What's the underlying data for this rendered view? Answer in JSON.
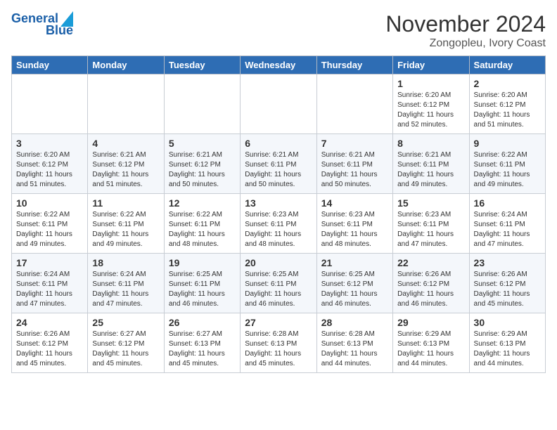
{
  "header": {
    "logo_line1": "General",
    "logo_line2": "Blue",
    "title": "November 2024",
    "subtitle": "Zongopleu, Ivory Coast"
  },
  "days_of_week": [
    "Sunday",
    "Monday",
    "Tuesday",
    "Wednesday",
    "Thursday",
    "Friday",
    "Saturday"
  ],
  "weeks": [
    [
      {
        "day": "",
        "info": ""
      },
      {
        "day": "",
        "info": ""
      },
      {
        "day": "",
        "info": ""
      },
      {
        "day": "",
        "info": ""
      },
      {
        "day": "",
        "info": ""
      },
      {
        "day": "1",
        "info": "Sunrise: 6:20 AM\nSunset: 6:12 PM\nDaylight: 11 hours\nand 52 minutes."
      },
      {
        "day": "2",
        "info": "Sunrise: 6:20 AM\nSunset: 6:12 PM\nDaylight: 11 hours\nand 51 minutes."
      }
    ],
    [
      {
        "day": "3",
        "info": "Sunrise: 6:20 AM\nSunset: 6:12 PM\nDaylight: 11 hours\nand 51 minutes."
      },
      {
        "day": "4",
        "info": "Sunrise: 6:21 AM\nSunset: 6:12 PM\nDaylight: 11 hours\nand 51 minutes."
      },
      {
        "day": "5",
        "info": "Sunrise: 6:21 AM\nSunset: 6:12 PM\nDaylight: 11 hours\nand 50 minutes."
      },
      {
        "day": "6",
        "info": "Sunrise: 6:21 AM\nSunset: 6:11 PM\nDaylight: 11 hours\nand 50 minutes."
      },
      {
        "day": "7",
        "info": "Sunrise: 6:21 AM\nSunset: 6:11 PM\nDaylight: 11 hours\nand 50 minutes."
      },
      {
        "day": "8",
        "info": "Sunrise: 6:21 AM\nSunset: 6:11 PM\nDaylight: 11 hours\nand 49 minutes."
      },
      {
        "day": "9",
        "info": "Sunrise: 6:22 AM\nSunset: 6:11 PM\nDaylight: 11 hours\nand 49 minutes."
      }
    ],
    [
      {
        "day": "10",
        "info": "Sunrise: 6:22 AM\nSunset: 6:11 PM\nDaylight: 11 hours\nand 49 minutes."
      },
      {
        "day": "11",
        "info": "Sunrise: 6:22 AM\nSunset: 6:11 PM\nDaylight: 11 hours\nand 49 minutes."
      },
      {
        "day": "12",
        "info": "Sunrise: 6:22 AM\nSunset: 6:11 PM\nDaylight: 11 hours\nand 48 minutes."
      },
      {
        "day": "13",
        "info": "Sunrise: 6:23 AM\nSunset: 6:11 PM\nDaylight: 11 hours\nand 48 minutes."
      },
      {
        "day": "14",
        "info": "Sunrise: 6:23 AM\nSunset: 6:11 PM\nDaylight: 11 hours\nand 48 minutes."
      },
      {
        "day": "15",
        "info": "Sunrise: 6:23 AM\nSunset: 6:11 PM\nDaylight: 11 hours\nand 47 minutes."
      },
      {
        "day": "16",
        "info": "Sunrise: 6:24 AM\nSunset: 6:11 PM\nDaylight: 11 hours\nand 47 minutes."
      }
    ],
    [
      {
        "day": "17",
        "info": "Sunrise: 6:24 AM\nSunset: 6:11 PM\nDaylight: 11 hours\nand 47 minutes."
      },
      {
        "day": "18",
        "info": "Sunrise: 6:24 AM\nSunset: 6:11 PM\nDaylight: 11 hours\nand 47 minutes."
      },
      {
        "day": "19",
        "info": "Sunrise: 6:25 AM\nSunset: 6:11 PM\nDaylight: 11 hours\nand 46 minutes."
      },
      {
        "day": "20",
        "info": "Sunrise: 6:25 AM\nSunset: 6:11 PM\nDaylight: 11 hours\nand 46 minutes."
      },
      {
        "day": "21",
        "info": "Sunrise: 6:25 AM\nSunset: 6:12 PM\nDaylight: 11 hours\nand 46 minutes."
      },
      {
        "day": "22",
        "info": "Sunrise: 6:26 AM\nSunset: 6:12 PM\nDaylight: 11 hours\nand 46 minutes."
      },
      {
        "day": "23",
        "info": "Sunrise: 6:26 AM\nSunset: 6:12 PM\nDaylight: 11 hours\nand 45 minutes."
      }
    ],
    [
      {
        "day": "24",
        "info": "Sunrise: 6:26 AM\nSunset: 6:12 PM\nDaylight: 11 hours\nand 45 minutes."
      },
      {
        "day": "25",
        "info": "Sunrise: 6:27 AM\nSunset: 6:12 PM\nDaylight: 11 hours\nand 45 minutes."
      },
      {
        "day": "26",
        "info": "Sunrise: 6:27 AM\nSunset: 6:13 PM\nDaylight: 11 hours\nand 45 minutes."
      },
      {
        "day": "27",
        "info": "Sunrise: 6:28 AM\nSunset: 6:13 PM\nDaylight: 11 hours\nand 45 minutes."
      },
      {
        "day": "28",
        "info": "Sunrise: 6:28 AM\nSunset: 6:13 PM\nDaylight: 11 hours\nand 44 minutes."
      },
      {
        "day": "29",
        "info": "Sunrise: 6:29 AM\nSunset: 6:13 PM\nDaylight: 11 hours\nand 44 minutes."
      },
      {
        "day": "30",
        "info": "Sunrise: 6:29 AM\nSunset: 6:13 PM\nDaylight: 11 hours\nand 44 minutes."
      }
    ]
  ]
}
